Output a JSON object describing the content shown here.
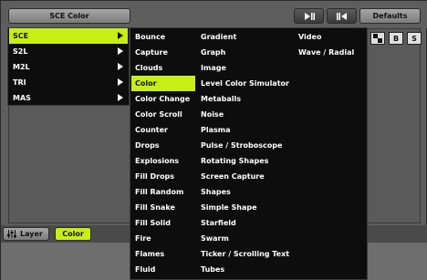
{
  "header": {
    "title_button": "SCE Color",
    "defaults_button": "Defaults"
  },
  "right_icons": {
    "b_label": "B",
    "s_label": "S"
  },
  "bottom": {
    "layer_button": "Layer",
    "color_button": "Color"
  },
  "submenu": {
    "items": [
      {
        "label": "SCE"
      },
      {
        "label": "S2L"
      },
      {
        "label": "M2L"
      },
      {
        "label": "TRI"
      },
      {
        "label": "MAS"
      }
    ]
  },
  "effects": {
    "col1": [
      "Bounce",
      "Capture",
      "Clouds",
      "Color",
      "Color Change",
      "Color Scroll",
      "Counter",
      "Drops",
      "Explosions",
      "Fill Drops",
      "Fill Random",
      "Fill Snake",
      "Fill Solid",
      "Fire",
      "Flames",
      "Fluid"
    ],
    "col2": [
      "Gradient",
      "Graph",
      "Image",
      "Level Color Simulator",
      "Metaballs",
      "Noise",
      "Plasma",
      "Pulse / Stroboscope",
      "Rotating Shapes",
      "Screen Capture",
      "Shapes",
      "Simple Shape",
      "Starfield",
      "Swarm",
      "Ticker / Scrolling Text",
      "Tubes"
    ],
    "col3": [
      "Video",
      "Wave / Radial"
    ],
    "selected": "Color"
  },
  "colors": {
    "accent": "#c8ee16",
    "menu_bg": "#0d0d0d"
  }
}
